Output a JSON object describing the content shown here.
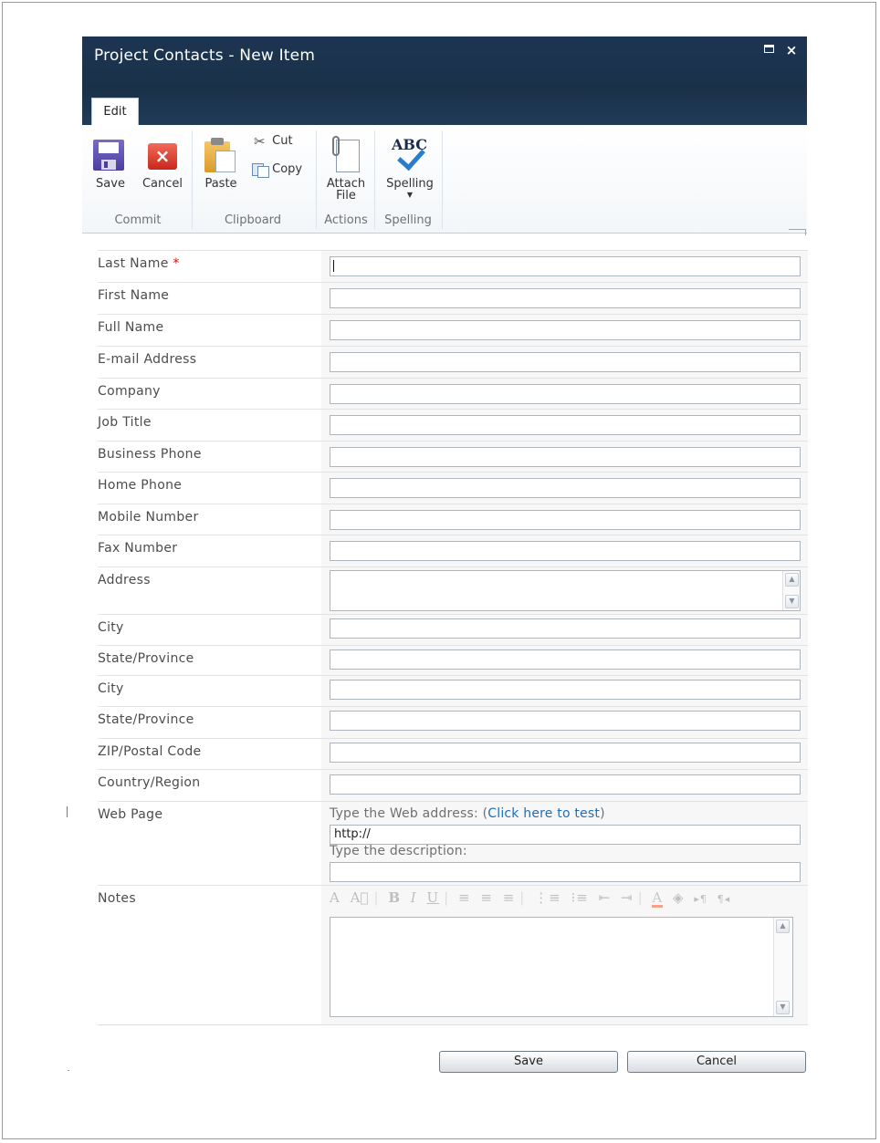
{
  "window": {
    "title": "Project Contacts - New Item",
    "close_glyph": "×"
  },
  "ribbon": {
    "tab": "Edit",
    "buttons": {
      "save": "Save",
      "cancel": "Cancel",
      "paste": "Paste",
      "cut": "Cut",
      "copy": "Copy",
      "attach_line1": "Attach",
      "attach_line2": "File",
      "spelling": "Spelling",
      "spelling_icon_text": "ABC"
    },
    "groups": {
      "commit": "Commit",
      "clipboard": "Clipboard",
      "actions": "Actions",
      "spelling": "Spelling"
    }
  },
  "form": {
    "required_marker": "*",
    "fields": [
      {
        "label": "Last Name",
        "value": ""
      },
      {
        "label": "First Name",
        "value": ""
      },
      {
        "label": "Full Name",
        "value": ""
      },
      {
        "label": "E-mail Address",
        "value": ""
      },
      {
        "label": "Company",
        "value": ""
      },
      {
        "label": "Job Title",
        "value": ""
      },
      {
        "label": "Business Phone",
        "value": ""
      },
      {
        "label": "Home Phone",
        "value": ""
      },
      {
        "label": "Mobile Number",
        "value": ""
      },
      {
        "label": "Fax Number",
        "value": ""
      },
      {
        "label": "Address",
        "value": ""
      },
      {
        "label": "City",
        "value": ""
      },
      {
        "label": "State/Province",
        "value": ""
      },
      {
        "label": "City",
        "value": ""
      },
      {
        "label": "State/Province",
        "value": ""
      },
      {
        "label": "ZIP/Postal Code",
        "value": ""
      },
      {
        "label": "Country/Region",
        "value": ""
      },
      {
        "label": "Web Page",
        "value": ""
      },
      {
        "label": "Notes",
        "value": ""
      }
    ],
    "web_page": {
      "address_prompt": "Type the Web address: (",
      "test_link": "Click here to test",
      "address_prompt_close": ")",
      "address_value": "http://",
      "description_prompt": "Type the description:",
      "description_value": ""
    },
    "rich_text_toolbar": [
      "A",
      "A⃞",
      "B",
      "I",
      "U",
      "≡",
      "≡",
      "≡",
      "⋮≡",
      "⁝≡",
      "⇤",
      "⇥",
      "A",
      "◈",
      "▸¶",
      "¶◂"
    ]
  },
  "actions": {
    "save": "Save",
    "cancel": "Cancel"
  },
  "colors": {
    "titlebar": "#1c3552",
    "link": "#1e6fb8",
    "required": "#cc1111"
  }
}
